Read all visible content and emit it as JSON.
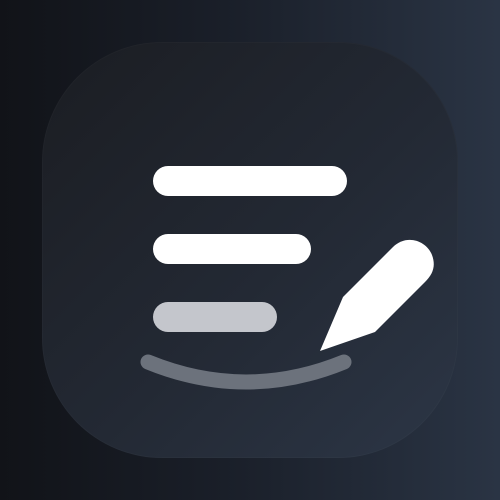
{
  "icon": {
    "name": "notes-edit-icon",
    "colors": {
      "background_dark": "#111318",
      "background_light": "#2a3444",
      "tile": "#232934",
      "line_primary": "#ffffff",
      "line_secondary": "#c4c6cc",
      "underline": "#6c727c",
      "pencil": "#ffffff"
    }
  }
}
